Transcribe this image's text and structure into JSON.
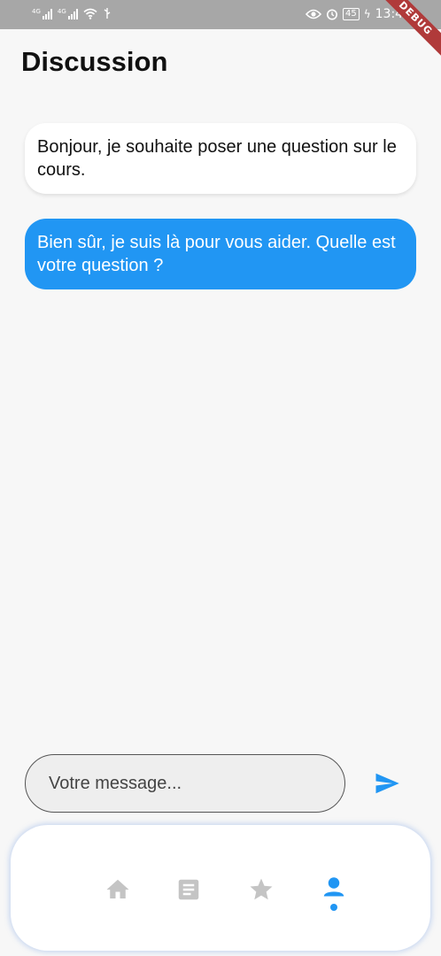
{
  "status_bar": {
    "signal1_label": "4G",
    "signal2_label": "4G",
    "battery": "45",
    "time": "13:41"
  },
  "debug_banner": "DEBUG",
  "header": {
    "title": "Discussion"
  },
  "messages": [
    {
      "sender": "user",
      "text": "Bonjour, je souhaite poser une question sur le cours."
    },
    {
      "sender": "bot",
      "text": "Bien sûr, je suis là pour vous aider. Quelle est votre question ?"
    }
  ],
  "composer": {
    "placeholder": "Votre message..."
  },
  "colors": {
    "accent": "#2196f3",
    "nav_inactive": "#c4c4c4",
    "status_bar": "#a7a7a7"
  },
  "bottom_nav": {
    "items": [
      {
        "icon": "home-icon",
        "active": false
      },
      {
        "icon": "document-icon",
        "active": false
      },
      {
        "icon": "star-icon",
        "active": false
      },
      {
        "icon": "person-icon",
        "active": true
      }
    ]
  }
}
